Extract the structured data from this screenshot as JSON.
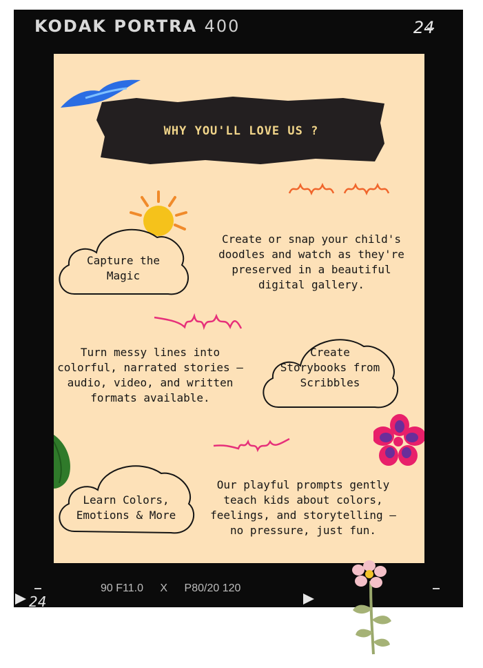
{
  "film": {
    "brand": "KODAK PORTRA",
    "speed": "400",
    "frame_top": "24",
    "frame_bottom": "24",
    "exposure": [
      "90 F11.0",
      "X",
      "P80/20 120"
    ]
  },
  "heading": "WHY YOU'LL LOVE US ?",
  "features": [
    {
      "title": "Capture the Magic",
      "description": "Create or snap your child's doodles and watch as they're preserved in a beautiful digital gallery."
    },
    {
      "title": "Create Storybooks from Scribbles",
      "description": "Turn messy lines into colorful, narrated stories — audio, video, and written formats available."
    },
    {
      "title": "Learn Colors, Emotions & More",
      "description": "Our playful prompts gently teach kids about colors, feelings, and storytelling — no pressure, just fun."
    }
  ],
  "colors": {
    "film": "#0b0b0b",
    "card": "#fde1b8",
    "banner": "#231f20",
    "heading": "#f1d58a",
    "bird": "#2a6de3",
    "sun": "#f5c21b",
    "sun_rays": "#f08a2a",
    "flower": "#e8206a",
    "flower_center": "#6a2e9a",
    "scribble_orange": "#f0652b",
    "scribble_pink": "#e6307a",
    "leaf": "#2f7a2a"
  },
  "icons": [
    "bird-icon",
    "sun-icon",
    "flower-icon",
    "leaf-icon",
    "pink-flower-icon",
    "scribble-icon"
  ]
}
